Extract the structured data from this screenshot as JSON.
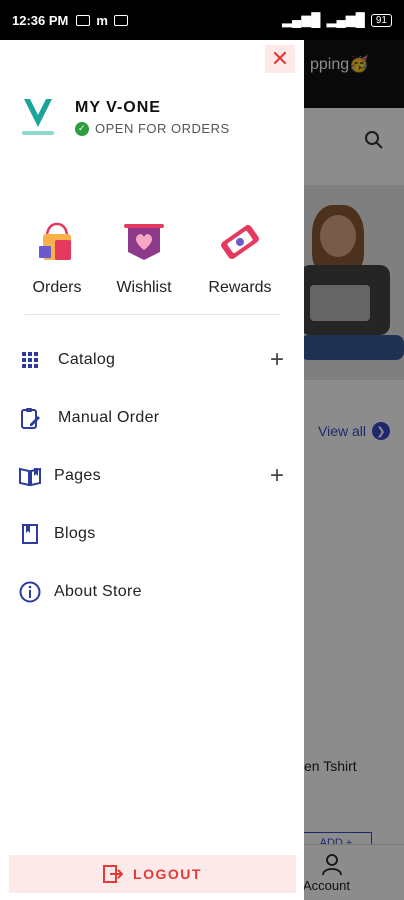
{
  "status_bar": {
    "time": "12:36 PM",
    "battery": "91"
  },
  "background": {
    "header_text": "pping🥳",
    "view_all": "View all",
    "product_name": "en Tshirt",
    "add_label": "ADD +",
    "account_label": "Account"
  },
  "drawer": {
    "store_name": "MY V-ONE",
    "store_status": "OPEN FOR ORDERS",
    "quick_actions": [
      {
        "label": "Orders",
        "icon": "shopping-bag-icon"
      },
      {
        "label": "Wishlist",
        "icon": "heart-banner-icon"
      },
      {
        "label": "Rewards",
        "icon": "ticket-icon"
      }
    ],
    "menu": [
      {
        "label": "Catalog",
        "icon": "grid-icon",
        "expandable": true
      },
      {
        "label": "Manual Order",
        "icon": "clipboard-edit-icon",
        "expandable": false
      },
      {
        "label": "Pages",
        "icon": "book-open-icon",
        "expandable": true
      },
      {
        "label": "Blogs",
        "icon": "bookmark-icon",
        "expandable": false
      },
      {
        "label": "About Store",
        "icon": "info-icon",
        "expandable": false
      }
    ],
    "logout_label": "LOGOUT"
  },
  "colors": {
    "accent": "#3a47c9",
    "danger": "#e53935",
    "success": "#2e9e3e"
  }
}
